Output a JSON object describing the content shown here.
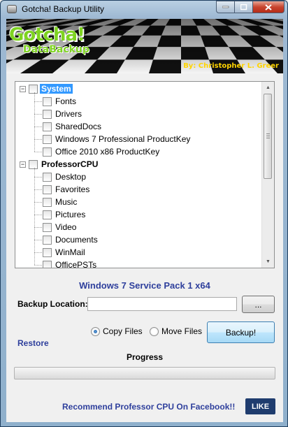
{
  "window": {
    "title": "Gotcha! Backup Utility",
    "minimize_icon": "minimize-icon",
    "maximize_icon": "maximize-icon",
    "close_icon": "close-icon"
  },
  "banner": {
    "logo_line1": "Gotcha!",
    "logo_line2": "DataBackup",
    "byline": "By: Christopher L. Greer"
  },
  "tree": {
    "roots": [
      {
        "label": "System",
        "expanded": true,
        "selected": true,
        "children": [
          "Fonts",
          "Drivers",
          "SharedDocs",
          "Windows 7 Professional ProductKey",
          "Office 2010 x86 ProductKey"
        ]
      },
      {
        "label": "ProfessorCPU",
        "expanded": true,
        "selected": false,
        "children": [
          "Desktop",
          "Favorites",
          "Music",
          "Pictures",
          "Video",
          "Documents",
          "WinMail",
          "OfficePSTs"
        ]
      }
    ],
    "expander_symbol": "−"
  },
  "os_label": "Windows 7 Service Pack 1 x64",
  "backup_location": {
    "label": "Backup Location:",
    "value": "",
    "browse_label": "..."
  },
  "mode": {
    "copy_label": "Copy Files",
    "move_label": "Move Files",
    "selected": "copy"
  },
  "backup_button": "Backup!",
  "restore_link": "Restore",
  "progress": {
    "label": "Progress",
    "value": 0
  },
  "footer": {
    "recommend": "Recommend Professor CPU On Facebook!!",
    "like_button": "LIKE"
  },
  "colors": {
    "link_blue": "#2e3f9c",
    "selection": "#3399ff",
    "logo_green": "#7ed321",
    "byline_yellow": "#ffd400"
  }
}
